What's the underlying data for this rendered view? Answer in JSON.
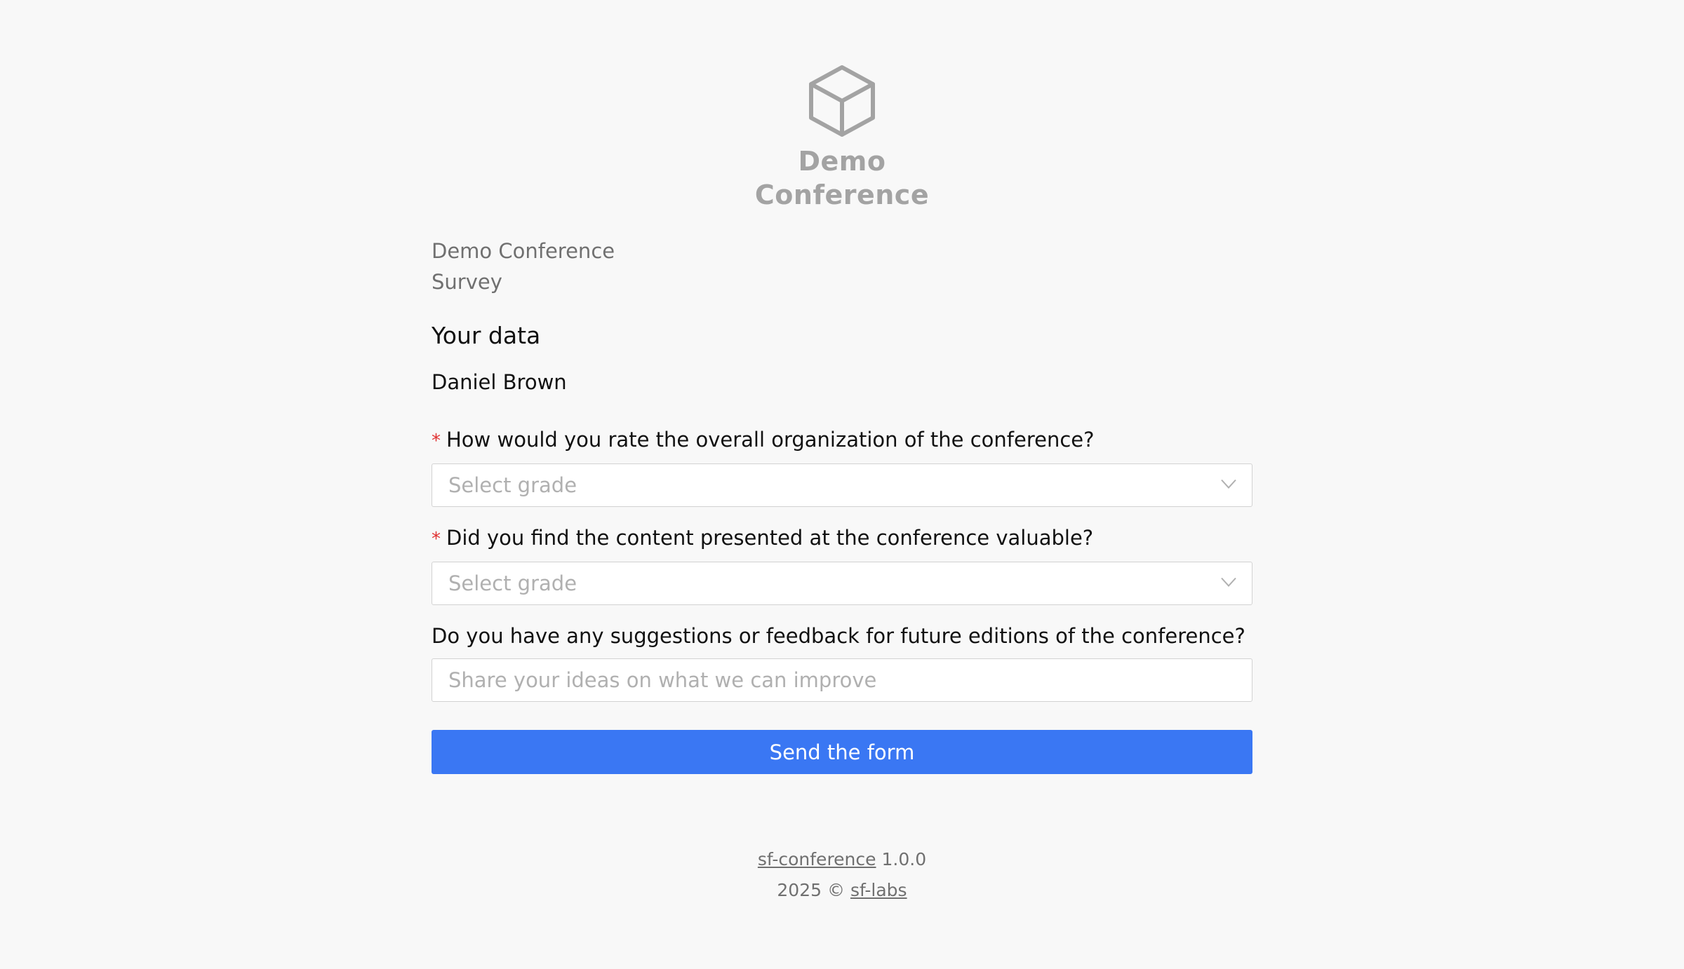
{
  "logo": {
    "line1": "Demo",
    "line2": "Conference",
    "icon": "cube-icon"
  },
  "survey": {
    "title": "Demo Conference Survey"
  },
  "section": {
    "title": "Your data",
    "user_name": "Daniel Brown"
  },
  "questions": [
    {
      "label": "How would you rate the overall organization of the conference?",
      "required": "*",
      "placeholder": "Select grade"
    },
    {
      "label": "Did you find the content presented at the conference valuable?",
      "required": "*",
      "placeholder": "Select grade"
    },
    {
      "label": "Do you have any suggestions or feedback for future editions of the conference?",
      "placeholder": "Share your ideas on what we can improve"
    }
  ],
  "submit": {
    "label": "Send the form"
  },
  "footer": {
    "app_link": "sf-conference",
    "version": "1.0.0",
    "copyright": "2025 ©",
    "org_link": "sf-labs"
  },
  "colors": {
    "primary": "#3a77f3",
    "required": "#e03131",
    "logo": "#a3a3a3",
    "background": "#f8f8f8"
  }
}
